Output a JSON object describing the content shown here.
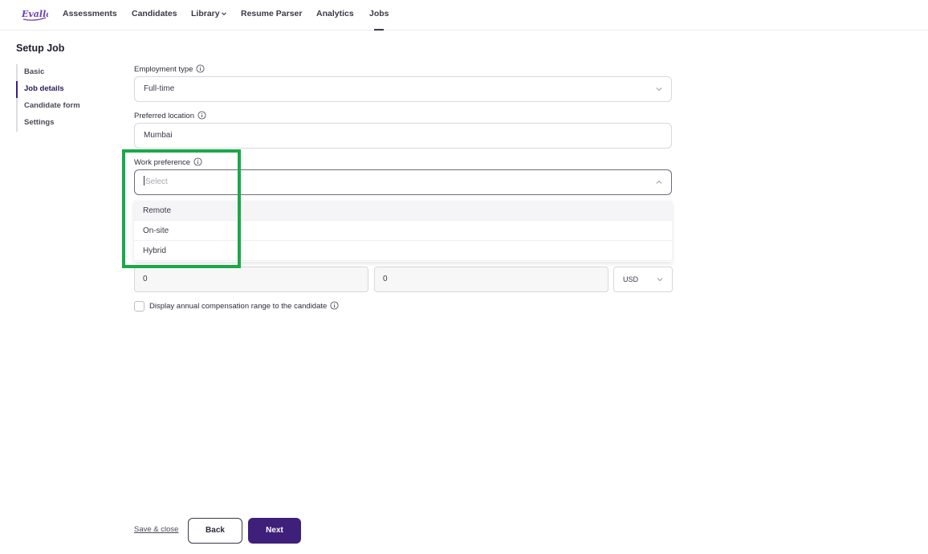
{
  "nav": {
    "logo_text": "Evalla",
    "items": [
      {
        "label": "Assessments"
      },
      {
        "label": "Candidates"
      },
      {
        "label": "Library"
      },
      {
        "label": "Resume Parser"
      },
      {
        "label": "Analytics"
      },
      {
        "label": "Jobs"
      }
    ],
    "active": "Jobs"
  },
  "page": {
    "title": "Setup Job"
  },
  "sidebar": {
    "items": [
      {
        "label": "Basic"
      },
      {
        "label": "Job details"
      },
      {
        "label": "Candidate form"
      },
      {
        "label": "Settings"
      }
    ],
    "active": "Job details"
  },
  "form": {
    "employment_type": {
      "label": "Employment type",
      "value": "Full-time"
    },
    "preferred_location": {
      "label": "Preferred location",
      "value": "Mumbai"
    },
    "work_preference": {
      "label": "Work preference",
      "placeholder": "Select",
      "options": [
        {
          "label": "Remote"
        },
        {
          "label": "On-site"
        },
        {
          "label": "Hybrid"
        }
      ]
    },
    "compensation": {
      "min": "0",
      "max": "0",
      "currency": "USD"
    },
    "display_range_label": "Display annual compensation range to the candidate"
  },
  "footer": {
    "save_close": "Save & close",
    "back": "Back",
    "next": "Next"
  },
  "colors": {
    "brand": "#3e1f7a",
    "highlight": "#1aa84a"
  },
  "icons": [
    "info-icon",
    "chevron-down-icon",
    "chevron-up-icon",
    "logo-icon"
  ]
}
